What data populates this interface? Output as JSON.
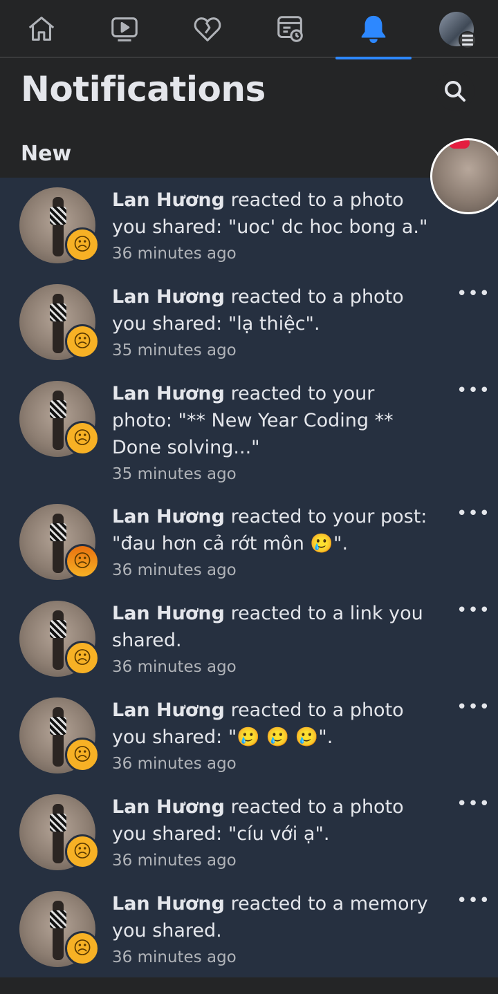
{
  "nav": {
    "items": [
      {
        "icon": "home-icon"
      },
      {
        "icon": "watch-icon"
      },
      {
        "icon": "dating-heart-icon"
      },
      {
        "icon": "memories-icon"
      },
      {
        "icon": "bell-icon",
        "active": true
      },
      {
        "icon": "profile-avatar-icon"
      }
    ],
    "accent": "#2d88ff"
  },
  "header": {
    "title": "Notifications",
    "search_icon": "search-icon"
  },
  "section": {
    "label": "New"
  },
  "notifications": [
    {
      "name": "Lan Hương",
      "action": "reacted to a photo you shared: \"uoc' dc hoc bong a.\"",
      "time": "36 minutes ago",
      "reaction": "sad"
    },
    {
      "name": "Lan Hương",
      "action": "reacted to a photo you shared: \"lạ thiệc\".",
      "time": "35 minutes ago",
      "reaction": "sad"
    },
    {
      "name": "Lan Hương",
      "action": "reacted to your photo: \"** New Year Coding ** Done solving...\"",
      "time": "35 minutes ago",
      "reaction": "sad"
    },
    {
      "name": "Lan Hương",
      "action": "reacted to your post: \"đau hơn cả rớt môn 🥲\".",
      "time": "36 minutes ago",
      "reaction": "angry"
    },
    {
      "name": "Lan Hương",
      "action": "reacted to a link you shared.",
      "time": "36 minutes ago",
      "reaction": "sad"
    },
    {
      "name": "Lan Hương",
      "action": "reacted to a photo you shared: \"🥲 🥲 🥲\".",
      "time": "36 minutes ago",
      "reaction": "sad"
    },
    {
      "name": "Lan Hương",
      "action": "reacted to a photo you shared: \"cíu với ạ\".",
      "time": "36 minutes ago",
      "reaction": "sad"
    },
    {
      "name": "Lan Hương",
      "action": "reacted to a memory you shared.",
      "time": "36 minutes ago",
      "reaction": "sad"
    }
  ],
  "more_label": "•••"
}
